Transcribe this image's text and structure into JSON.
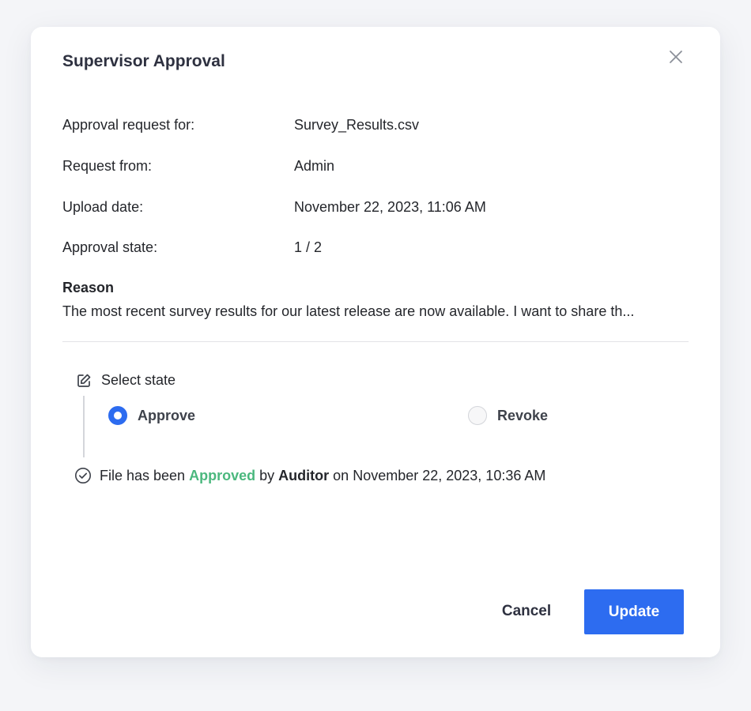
{
  "dialog": {
    "title": "Supervisor Approval",
    "close_icon": "close-icon"
  },
  "details": [
    {
      "label": "Approval request for:",
      "value": "Survey_Results.csv"
    },
    {
      "label": "Request from:",
      "value": "Admin"
    },
    {
      "label": "Upload date:",
      "value": "November 22, 2023, 11:06 AM"
    },
    {
      "label": "Approval state:",
      "value": "1 / 2"
    }
  ],
  "reason": {
    "title": "Reason",
    "text": "The most recent survey results for our latest release are now available. I want to share th..."
  },
  "state_select": {
    "label": "Select state",
    "icon": "edit-icon",
    "options": [
      {
        "label": "Approve",
        "selected": true
      },
      {
        "label": "Revoke",
        "selected": false
      }
    ]
  },
  "history": {
    "icon": "check-circle-icon",
    "prefix": "File has been",
    "status": "Approved",
    "by_text": "by",
    "user": "Auditor",
    "on_text": "on",
    "date": "November 22, 2023, 10:36 AM",
    "status_color": "#4bb87e"
  },
  "actions": {
    "cancel_label": "Cancel",
    "update_label": "Update"
  },
  "colors": {
    "accent": "#2d6cf0",
    "success": "#4bb87e"
  }
}
